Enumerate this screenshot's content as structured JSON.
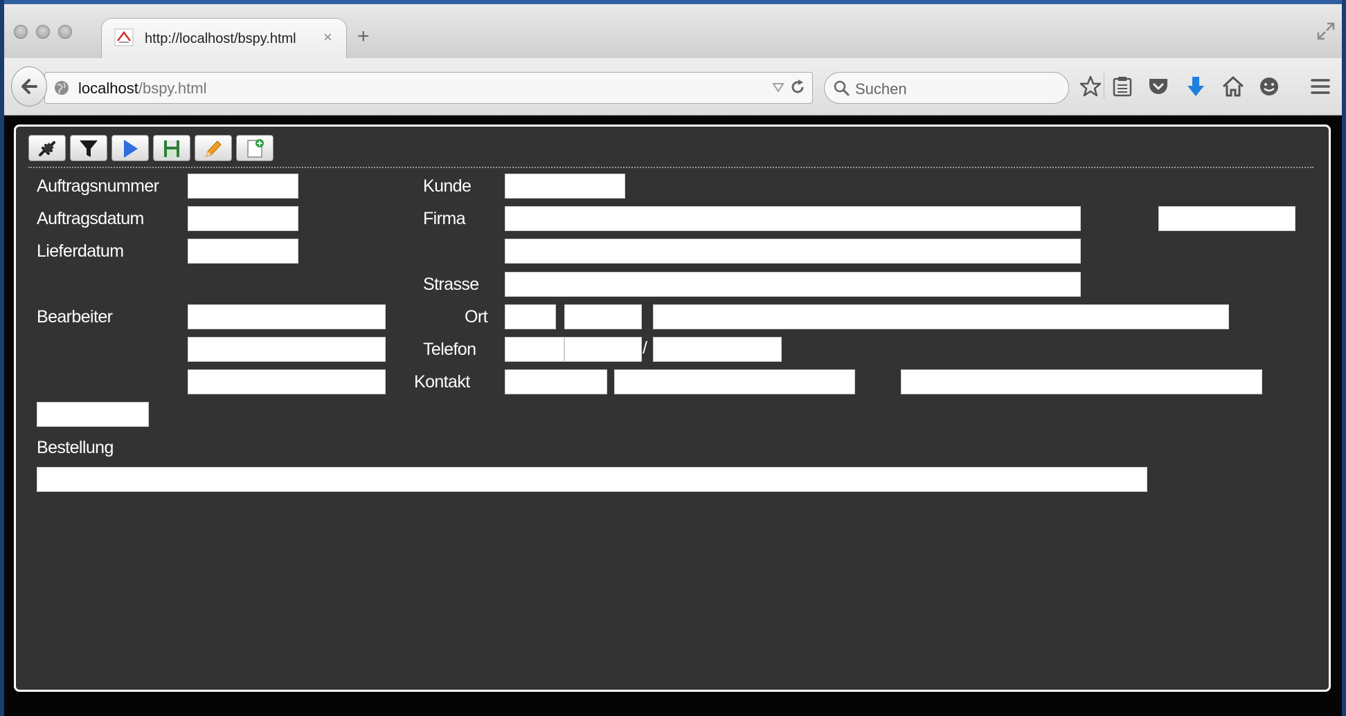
{
  "browser": {
    "tab_title": "http://localhost/bspy.html",
    "tab_close": "×",
    "new_tab": "+",
    "url_host": "localhost",
    "url_path": "/bspy.html",
    "search_placeholder": "Suchen"
  },
  "toolbar": {
    "buttons": [
      "connect",
      "filter",
      "run",
      "save",
      "edit",
      "new-document"
    ]
  },
  "form": {
    "labels": {
      "auftragsnummer": "Auftragsnummer",
      "auftragsdatum": "Auftragsdatum",
      "lieferdatum": "Lieferdatum",
      "bearbeiter": "Bearbeiter",
      "kunde": "Kunde",
      "firma": "Firma",
      "strasse": "Strasse",
      "ort": "Ort",
      "telefon": "Telefon",
      "kontakt": "Kontakt",
      "bestellung": "Bestellung"
    },
    "phone_separator": "/",
    "values": {
      "auftragsnummer": "",
      "auftragsdatum": "",
      "lieferdatum": "",
      "bearbeiter_1": "",
      "bearbeiter_2": "",
      "bearbeiter_3": "",
      "extra": "",
      "kunde": "",
      "firma_1": "",
      "firma_2": "",
      "firma_extra": "",
      "strasse": "",
      "ort_land": "",
      "ort_plz": "",
      "ort_name": "",
      "telefon_land": "",
      "telefon_vorwahl": "",
      "telefon_nummer": "",
      "kontakt_anrede": "",
      "kontakt_name": "",
      "kontakt_email": "",
      "bestellung": ""
    }
  }
}
